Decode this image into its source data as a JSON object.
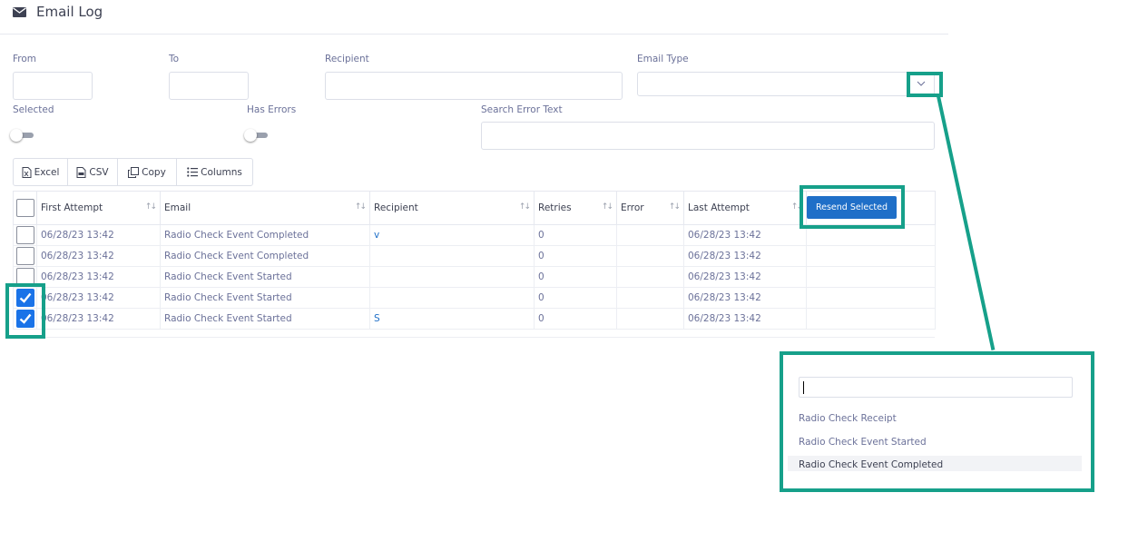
{
  "header": {
    "title": "Email Log",
    "icon": "envelope-icon"
  },
  "filters": {
    "from_label": "From",
    "to_label": "To",
    "recipient_label": "Recipient",
    "email_type_label": "Email Type",
    "selected_label": "Selected",
    "has_errors_label": "Has Errors",
    "search_error_label": "Search Error Text",
    "selected_on": false,
    "has_errors_on": false
  },
  "toolbar": {
    "excel": "Excel",
    "csv": "CSV",
    "copy": "Copy",
    "columns": "Columns"
  },
  "table": {
    "columns": [
      "First Attempt",
      "Email",
      "Recipient",
      "Retries",
      "Error",
      "Last Attempt"
    ],
    "resend_label": "Resend Selected",
    "rows": [
      {
        "checked": false,
        "first_attempt": "06/28/23 13:42",
        "email": "Radio Check Event Completed",
        "recipient": "v",
        "retries": "0",
        "error": "",
        "last_attempt": "06/28/23 13:42"
      },
      {
        "checked": false,
        "first_attempt": "06/28/23 13:42",
        "email": "Radio Check Event Completed",
        "recipient": "",
        "retries": "0",
        "error": "",
        "last_attempt": "06/28/23 13:42"
      },
      {
        "checked": false,
        "first_attempt": "06/28/23 13:42",
        "email": "Radio Check Event Started",
        "recipient": "",
        "retries": "0",
        "error": "",
        "last_attempt": "06/28/23 13:42"
      },
      {
        "checked": true,
        "first_attempt": "06/28/23 13:42",
        "email": "Radio Check Event Started",
        "recipient": "",
        "retries": "0",
        "error": "",
        "last_attempt": "06/28/23 13:42"
      },
      {
        "checked": true,
        "first_attempt": "06/28/23 13:42",
        "email": "Radio Check Event Started",
        "recipient": "S",
        "retries": "0",
        "error": "",
        "last_attempt": "06/28/23 13:42"
      }
    ]
  },
  "email_type_dropdown": {
    "search_value": "",
    "options": [
      "Radio Check Receipt",
      "Radio Check Event Started",
      "Radio Check Event Completed"
    ],
    "highlighted_index": 2
  },
  "colors": {
    "accent": "#1f6fc8",
    "highlight": "#16a08a",
    "checkbox": "#1a73e8"
  }
}
